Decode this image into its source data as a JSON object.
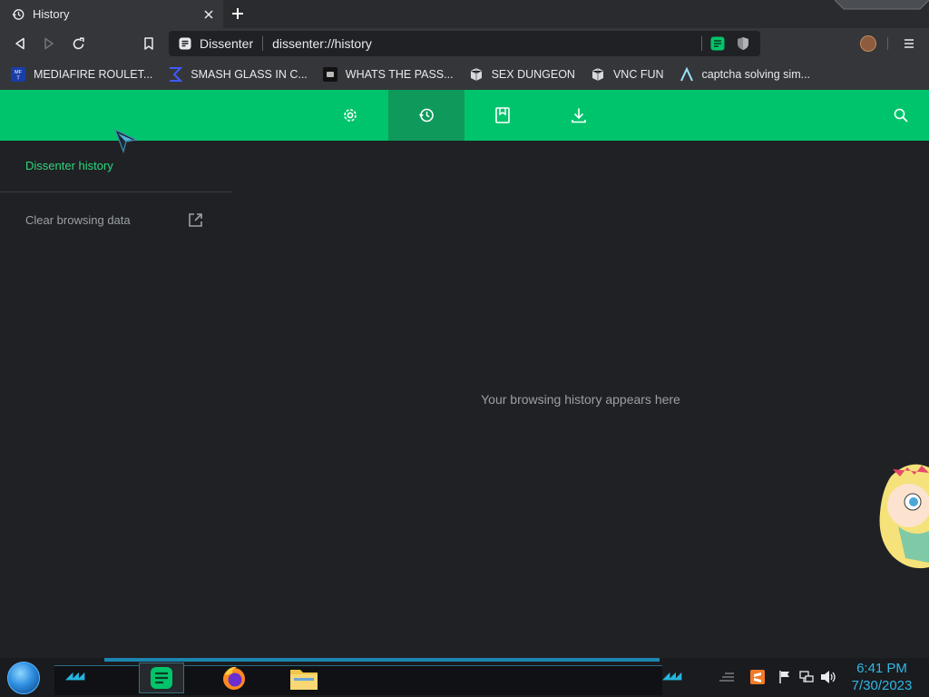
{
  "tab": {
    "title": "History",
    "history_icon": "history-icon",
    "close_icon": "close-icon"
  },
  "toolbar": {
    "site_name": "Dissenter",
    "url": "dissenter://history",
    "icons": [
      "back-icon",
      "forward-icon",
      "reload-icon",
      "bookmark-icon",
      "dissenter-extension-icon",
      "shield-icon",
      "avatar",
      "menu-icon"
    ]
  },
  "bookmarks": [
    {
      "label": "MEDIAFIRE ROULET...",
      "icon": "mediafire-icon"
    },
    {
      "label": "SMASH GLASS IN C...",
      "icon": "sigma-icon"
    },
    {
      "label": "WHATS THE PASS...",
      "icon": "site-icon"
    },
    {
      "label": "SEX DUNGEON",
      "icon": "site-icon"
    },
    {
      "label": "VNC FUN",
      "icon": "site-icon"
    },
    {
      "label": "captcha solving sim...",
      "icon": "lambda-icon"
    }
  ],
  "header": {
    "tabs": [
      "settings-icon",
      "history-icon",
      "bookmarks-icon",
      "downloads-icon"
    ],
    "active_tab": "history-icon",
    "accent": "#00c46b",
    "active_bg": "#0f9a5c"
  },
  "sidebar": {
    "title": "Dissenter history",
    "clear_label": "Clear browsing data"
  },
  "main": {
    "empty_message": "Your browsing history appears here"
  },
  "taskbar": {
    "time": "6:41 PM",
    "date": "7/30/2023",
    "apps": [
      "dissenter-app-icon",
      "firefox-icon",
      "file-explorer-icon"
    ]
  }
}
